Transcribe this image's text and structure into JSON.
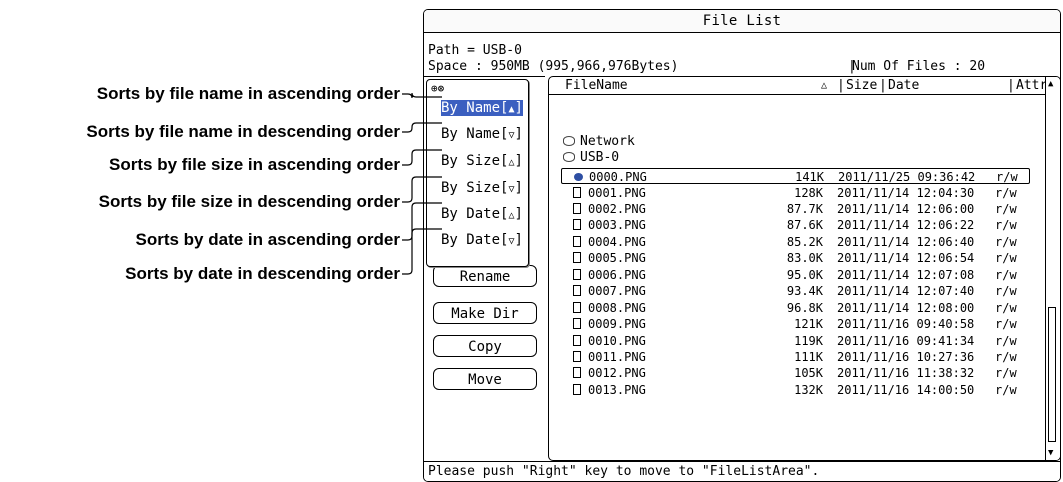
{
  "window": {
    "title": "File List",
    "path": "Path = USB-0",
    "space": "Space : 950MB (995,966,976Bytes)",
    "num_files": "Num Of Files : 20"
  },
  "columns": {
    "filename": "FileName",
    "sort_indicator": "△",
    "size": "Size",
    "date": "Date",
    "attr": "Attr"
  },
  "drives": [
    "Network",
    "USB-0"
  ],
  "files": [
    {
      "name": "0000.PNG",
      "size": "141K",
      "date": "2011/11/25 09:36:42",
      "attr": "r/w",
      "selected": true
    },
    {
      "name": "0001.PNG",
      "size": "128K",
      "date": "2011/11/14 12:04:30",
      "attr": "r/w"
    },
    {
      "name": "0002.PNG",
      "size": "87.7K",
      "date": "2011/11/14 12:06:00",
      "attr": "r/w"
    },
    {
      "name": "0003.PNG",
      "size": "87.6K",
      "date": "2011/11/14 12:06:22",
      "attr": "r/w"
    },
    {
      "name": "0004.PNG",
      "size": "85.2K",
      "date": "2011/11/14 12:06:40",
      "attr": "r/w"
    },
    {
      "name": "0005.PNG",
      "size": "83.0K",
      "date": "2011/11/14 12:06:54",
      "attr": "r/w"
    },
    {
      "name": "0006.PNG",
      "size": "95.0K",
      "date": "2011/11/14 12:07:08",
      "attr": "r/w"
    },
    {
      "name": "0007.PNG",
      "size": "93.4K",
      "date": "2011/11/14 12:07:40",
      "attr": "r/w"
    },
    {
      "name": "0008.PNG",
      "size": "96.8K",
      "date": "2011/11/14 12:08:00",
      "attr": "r/w"
    },
    {
      "name": "0009.PNG",
      "size": "121K",
      "date": "2011/11/16 09:40:58",
      "attr": "r/w"
    },
    {
      "name": "0010.PNG",
      "size": "119K",
      "date": "2011/11/16 09:41:34",
      "attr": "r/w"
    },
    {
      "name": "0011.PNG",
      "size": "111K",
      "date": "2011/11/16 10:27:36",
      "attr": "r/w"
    },
    {
      "name": "0012.PNG",
      "size": "105K",
      "date": "2011/11/16 11:38:32",
      "attr": "r/w"
    },
    {
      "name": "0013.PNG",
      "size": "132K",
      "date": "2011/11/16 14:00:50",
      "attr": "r/w"
    }
  ],
  "buttons": {
    "rename": "Rename",
    "make_dir": "Make Dir",
    "copy": "Copy",
    "move": "Move"
  },
  "sort_popup": {
    "options": [
      {
        "label": "By Name",
        "arrow": "▲",
        "active": true
      },
      {
        "label": "By Name",
        "arrow": "▽",
        "active": false
      },
      {
        "label": "By Size",
        "arrow": "△",
        "active": false
      },
      {
        "label": "By Size",
        "arrow": "▽",
        "active": false
      },
      {
        "label": "By Date",
        "arrow": "△",
        "active": false
      },
      {
        "label": "By Date",
        "arrow": "▽",
        "active": false
      }
    ]
  },
  "callouts": [
    "Sorts by file name in ascending order",
    "Sorts by file name in descending order",
    "Sorts by file size in ascending order",
    "Sorts by file size in descending order",
    "Sorts by date in ascending order",
    "Sorts by date in descending order"
  ],
  "status": "Please push \"Right\" key to move to \"FileListArea\".",
  "colors": {
    "highlight": "#3b5fc0",
    "current_file_icon": "#2e4fa3"
  },
  "icons": {
    "drive": "drive-icon",
    "file": "file-icon",
    "current_file": "current-file-icon",
    "scroll_up": "scroll-up-arrow-icon",
    "scroll_down": "scroll-down-arrow-icon",
    "rotary_set": "rotary-set-icon"
  }
}
